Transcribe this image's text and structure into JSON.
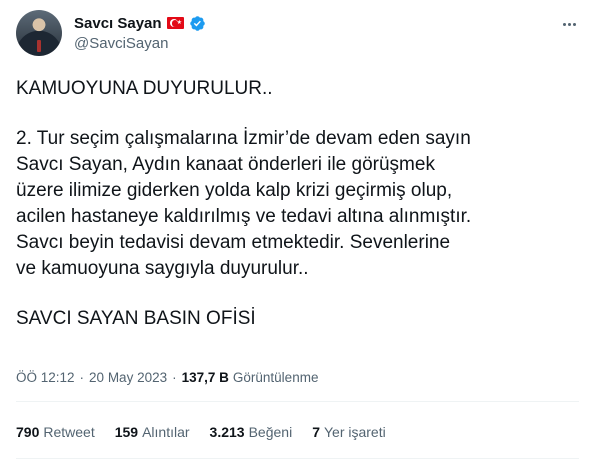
{
  "author": {
    "display_name": "Savcı Sayan",
    "handle": "@SavciSayan"
  },
  "tweet": {
    "title": "KAMUOYUNA DUYURULUR..",
    "paragraph": "2. Tur seçim çalışmalarına İzmir’de devam eden sayın\nSavcı Sayan, Aydın kanaat önderleri ile görüşmek\nüzere ilimize giderken yolda kalp krizi geçirmiş olup,\nacilen hastaneye kaldırılmış ve tedavi altına alınmıştır.\nSavcı beyin tedavisi devam etmektedir. Sevenlerine\nve kamuoyuna saygıyla duyurulur..",
    "signature": "SAVCI SAYAN BASIN OFİSİ"
  },
  "meta": {
    "time": "ÖÖ 12:12",
    "separator": "·",
    "date": "20 May 2023",
    "views_count": "137,7 B",
    "views_label": "Görüntülenme"
  },
  "stats": [
    {
      "count": "790",
      "label": "Retweet"
    },
    {
      "count": "159",
      "label": "Alıntılar"
    },
    {
      "count": "3.213",
      "label": "Beğeni"
    },
    {
      "count": "7",
      "label": "Yer işareti"
    }
  ],
  "icons": {
    "verified": "verified-badge-icon",
    "flag": "turkey-flag-icon",
    "more": "more-options-icon"
  },
  "colors": {
    "text": "#0f1419",
    "secondary": "#536471",
    "verified": "#1d9bf0"
  }
}
